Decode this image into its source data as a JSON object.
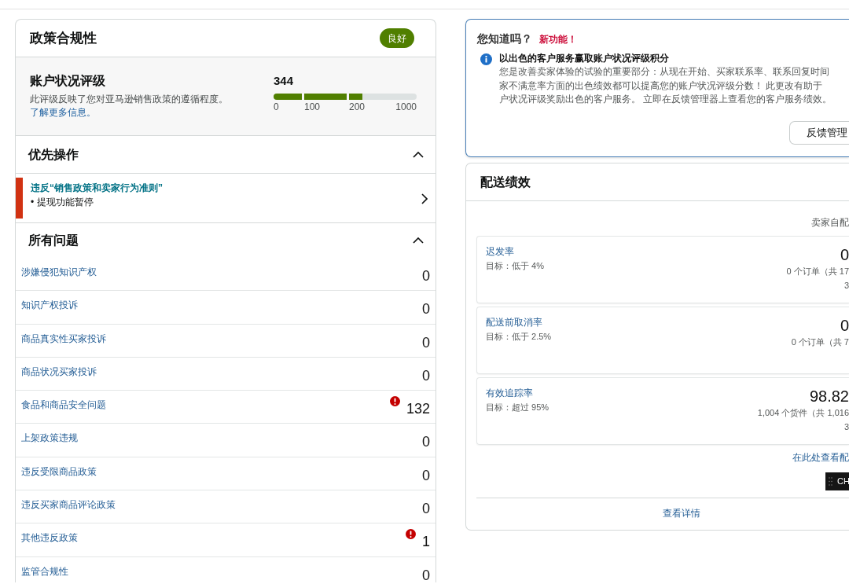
{
  "policy_compliance": {
    "title": "政策合规性",
    "status_badge": "良好",
    "account_health": {
      "title": "账户状况评级",
      "description": "此评级反映了您对亚马逊销售政策的遵循程度。",
      "link": "了解更多信息。",
      "score": "344",
      "segments": [
        {
          "level": 1
        },
        {
          "level": 1
        },
        {
          "level": 0.2
        }
      ],
      "scale_labels": [
        "0",
        "100",
        "200",
        "1000"
      ]
    },
    "priority_actions": {
      "title": "优先操作",
      "expanded": true,
      "items": [
        {
          "title": "违反“销售政策和卖家行为准则”",
          "detail": "• 提现功能暂停"
        }
      ]
    },
    "all_issues": {
      "title": "所有问题",
      "expanded": true,
      "rows": [
        {
          "label": "涉嫌侵犯知识产权",
          "count": "0",
          "alert": false
        },
        {
          "label": "知识产权投诉",
          "count": "0",
          "alert": false
        },
        {
          "label": "商品真实性买家投诉",
          "count": "0",
          "alert": false
        },
        {
          "label": "商品状况买家投诉",
          "count": "0",
          "alert": false
        },
        {
          "label": "食品和商品安全问题",
          "count": "132",
          "alert": true
        },
        {
          "label": "上架政策违规",
          "count": "0",
          "alert": false
        },
        {
          "label": "违反受限商品政策",
          "count": "0",
          "alert": false
        },
        {
          "label": "违反买家商品评论政策",
          "count": "0",
          "alert": false
        },
        {
          "label": "其他违反政策",
          "count": "1",
          "alert": true
        },
        {
          "label": "监管合规性",
          "count": "0",
          "alert": false
        }
      ]
    }
  },
  "did_you_know": {
    "title": "您知道吗？",
    "badge": "新功能！",
    "heading": "以出色的客户服务赢取账户状况评级积分",
    "body_lines": [
      "您是改善卖家体验的试验的重要部分：从现在开始、买家联系率、联系回复时间",
      "家不满意率方面的出色绩效都可以提高您的账户状况评级分数！ 此更改有助于",
      "户状况评级奖励出色的客户服务。 立即在反馈管理器上查看您的客户服务绩效。"
    ],
    "button": "反馈管理"
  },
  "shipping_performance": {
    "title": "配送绩效",
    "column_header": "卖家自配",
    "metrics": [
      {
        "name": "迟发率",
        "target": "目标：低于 4%",
        "value": "0",
        "detail_lines": [
          "0 个订单（共 17",
          "3"
        ]
      },
      {
        "name": "配送前取消率",
        "target": "目标：低于 2.5%",
        "value": "0",
        "detail_lines": [
          "0 个订单（共 7"
        ]
      },
      {
        "name": "有效追踪率",
        "target": "目标：超过 95%",
        "value": "98.82",
        "detail_lines": [
          "1,004 个货件（共 1,016",
          "3"
        ]
      }
    ],
    "link": "在此处查看配",
    "dark_button": "CH",
    "footer_link": "查看详情"
  }
}
